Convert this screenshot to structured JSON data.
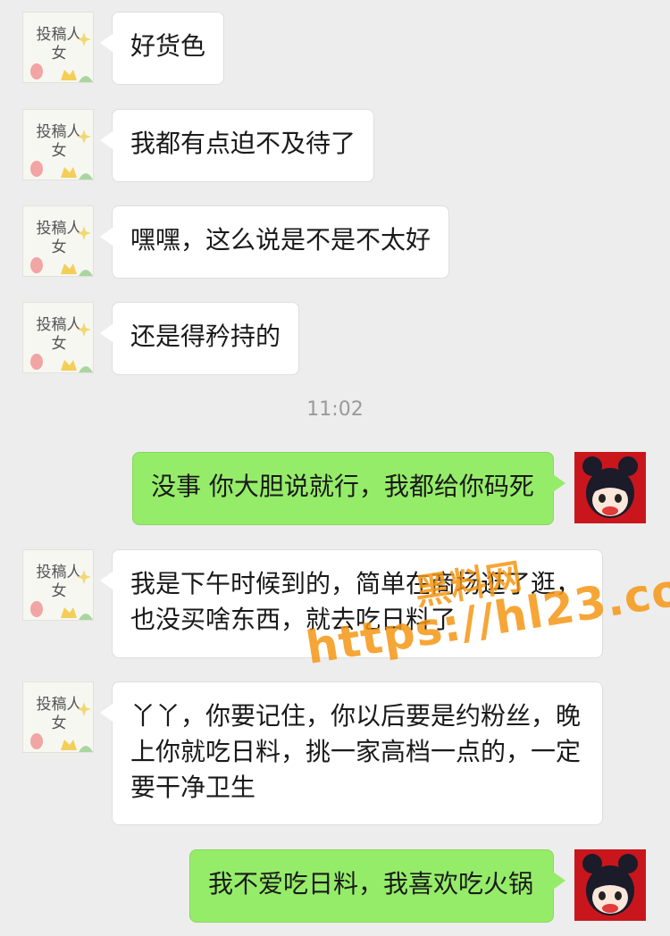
{
  "chat": {
    "incoming_avatar_text": [
      "投稿人",
      "女"
    ],
    "messages": [
      {
        "side": "left",
        "text": "好货色"
      },
      {
        "side": "left",
        "text": "我都有点迫不及待了"
      },
      {
        "side": "left",
        "text": "嘿嘿，这么说是不是不太好"
      },
      {
        "side": "left",
        "text": "还是得矜持的"
      },
      {
        "side": "right",
        "text": "没事 你大胆说就行，我都给你码死"
      },
      {
        "side": "left",
        "text": "我是下午时候到的，简单在商场逛了逛，也没买啥东西，就去吃日料了"
      },
      {
        "side": "left",
        "text": "丫丫，你要记住，你以后要是约粉丝，晚上你就吃日料，挑一家高档一点的，一定要干净卫生"
      },
      {
        "side": "right",
        "text": "我不爱吃日料，我喜欢吃火锅"
      }
    ],
    "timestamp": "11:02"
  },
  "watermark": {
    "line1": "黑料网",
    "line2": "https://hl23.co"
  },
  "colors": {
    "background": "#ededed",
    "incoming_bubble": "#ffffff",
    "outgoing_bubble": "#95ec69",
    "outgoing_avatar": "#c9161c",
    "watermark": "#f59614"
  }
}
